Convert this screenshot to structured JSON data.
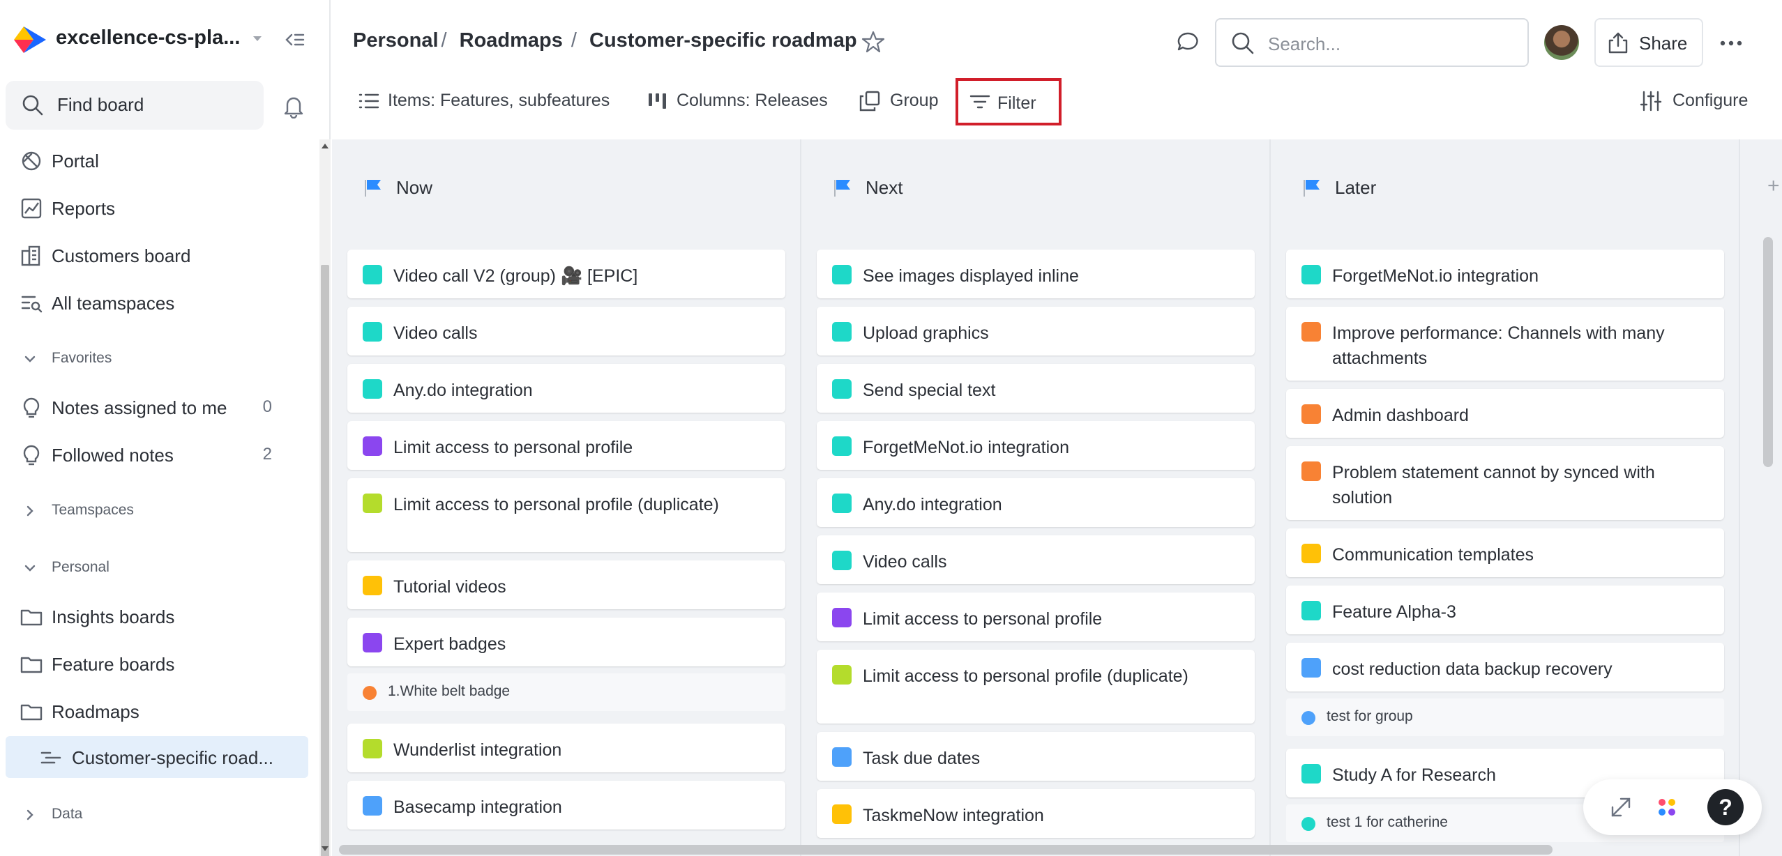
{
  "workspace": {
    "name": "excellence-cs-pla..."
  },
  "sidebar": {
    "find_board": "Find board",
    "items": [
      {
        "label": "Portal",
        "icon": "portal-icon"
      },
      {
        "label": "Reports",
        "icon": "reports-icon"
      },
      {
        "label": "Customers board",
        "icon": "customers-board-icon"
      },
      {
        "label": "All teamspaces",
        "icon": "teamspaces-icon"
      }
    ],
    "favorites": {
      "label": "Favorites",
      "items": [
        {
          "label": "Notes assigned to me",
          "count": "0"
        },
        {
          "label": "Followed notes",
          "count": "2"
        }
      ]
    },
    "teamspaces_label": "Teamspaces",
    "personal": {
      "label": "Personal",
      "folders": [
        "Insights boards",
        "Feature boards",
        "Roadmaps"
      ],
      "active_item": "Customer-specific road..."
    },
    "data_label": "Data"
  },
  "header": {
    "breadcrumb": [
      "Personal",
      "Roadmaps",
      "Customer-specific roadmap"
    ],
    "search_placeholder": "Search...",
    "share_label": "Share"
  },
  "toolbar": {
    "items_label": "Items: Features, subfeatures",
    "columns_label": "Columns: Releases",
    "group_label": "Group",
    "filter_label": "Filter",
    "configure_label": "Configure"
  },
  "colors": {
    "teal": "#1ed8c8",
    "purple": "#8b46ef",
    "lime": "#b4dc2c",
    "yellow": "#ffc107",
    "orange": "#f88234",
    "blue": "#4ea1fa",
    "flag": "#2b8cff",
    "highlight": "#d11e2a"
  },
  "board": {
    "columns": [
      {
        "title": "Now",
        "cards": [
          {
            "kind": "card",
            "text": "Video call V2 (group) 🎥 [EPIC]",
            "color": "teal"
          },
          {
            "kind": "card",
            "text": "Video calls",
            "color": "teal"
          },
          {
            "kind": "card",
            "text": "Any.do integration",
            "color": "teal"
          },
          {
            "kind": "card",
            "text": "Limit access to personal profile",
            "color": "purple"
          },
          {
            "kind": "card",
            "text": "Limit access to personal profile (duplicate)",
            "color": "lime",
            "tall": true
          },
          {
            "kind": "card",
            "text": "Tutorial videos",
            "color": "yellow"
          },
          {
            "kind": "card",
            "text": "Expert badges",
            "color": "purple"
          },
          {
            "kind": "sub",
            "text": "1.White belt badge",
            "color": "orange"
          },
          {
            "kind": "card",
            "text": "Wunderlist integration",
            "color": "lime"
          },
          {
            "kind": "card",
            "text": "Basecamp integration",
            "color": "blue"
          }
        ]
      },
      {
        "title": "Next",
        "cards": [
          {
            "kind": "card",
            "text": "See images displayed inline",
            "color": "teal"
          },
          {
            "kind": "card",
            "text": "Upload graphics",
            "color": "teal"
          },
          {
            "kind": "card",
            "text": "Send special text",
            "color": "teal"
          },
          {
            "kind": "card",
            "text": "ForgetMeNot.io integration",
            "color": "teal"
          },
          {
            "kind": "card",
            "text": "Any.do integration",
            "color": "teal"
          },
          {
            "kind": "card",
            "text": "Video calls",
            "color": "teal"
          },
          {
            "kind": "card",
            "text": "Limit access to personal profile",
            "color": "purple"
          },
          {
            "kind": "card",
            "text": "Limit access to personal profile (duplicate)",
            "color": "lime",
            "tall": true
          },
          {
            "kind": "card",
            "text": "Task due dates",
            "color": "blue"
          },
          {
            "kind": "card",
            "text": "TaskmeNow integration",
            "color": "yellow"
          }
        ]
      },
      {
        "title": "Later",
        "cards": [
          {
            "kind": "card",
            "text": "ForgetMeNot.io integration",
            "color": "teal"
          },
          {
            "kind": "card",
            "text": "Improve performance: Channels with many attachments",
            "color": "orange",
            "tall": true
          },
          {
            "kind": "card",
            "text": "Admin dashboard",
            "color": "orange"
          },
          {
            "kind": "card",
            "text": "Problem statement cannot by synced with solution",
            "color": "orange",
            "tall": true
          },
          {
            "kind": "card",
            "text": "Communication templates",
            "color": "yellow"
          },
          {
            "kind": "card",
            "text": "Feature Alpha-3",
            "color": "teal"
          },
          {
            "kind": "card",
            "text": "cost reduction data backup recovery",
            "color": "blue"
          },
          {
            "kind": "sub",
            "text": "test for group",
            "color": "blue"
          },
          {
            "kind": "card",
            "text": "Study A for Research",
            "color": "teal"
          },
          {
            "kind": "sub",
            "text": "test 1 for catherine",
            "color": "teal"
          }
        ]
      }
    ]
  },
  "widget": {
    "help_label": "?"
  }
}
